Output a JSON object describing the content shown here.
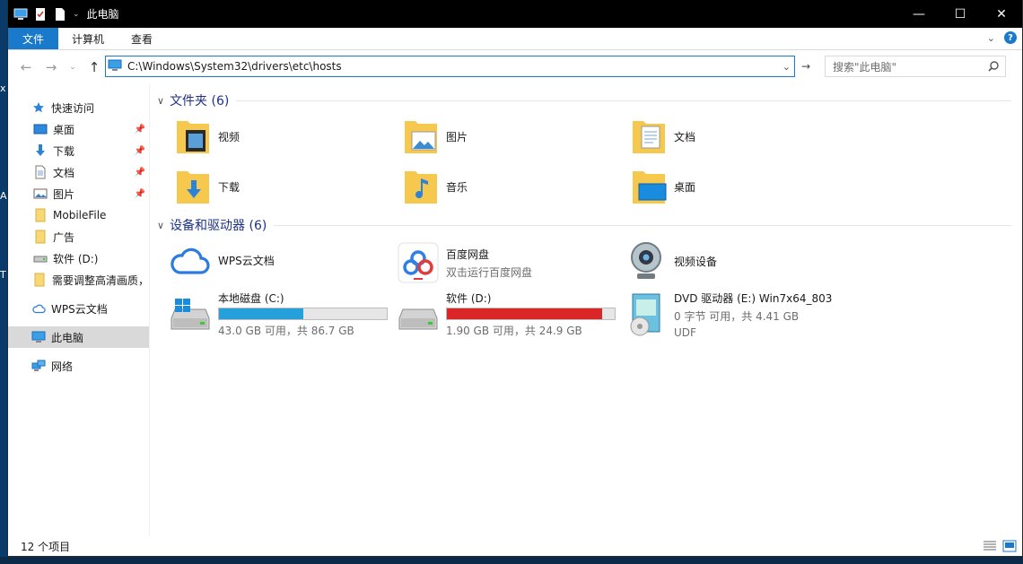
{
  "window": {
    "title": "此电脑"
  },
  "ribbon": {
    "tabs": [
      "文件",
      "计算机",
      "查看"
    ]
  },
  "navbar": {
    "address": "C:\\Windows\\System32\\drivers\\etc\\hosts",
    "search_placeholder": "搜索\"此电脑\""
  },
  "sidebar": {
    "quick_access": "快速访问",
    "pinned": [
      "桌面",
      "下载",
      "文档",
      "图片"
    ],
    "folders": [
      "MobileFile",
      "广告",
      "软件 (D:)",
      "需要调整高清画质，"
    ],
    "wps": "WPS云文档",
    "this_pc": "此电脑",
    "network": "网络"
  },
  "folders": {
    "header": "文件夹 (6)",
    "items": [
      "视频",
      "图片",
      "文档",
      "下载",
      "音乐",
      "桌面"
    ]
  },
  "devices": {
    "header": "设备和驱动器 (6)",
    "wps": "WPS云文档",
    "baidu_name": "百度网盘",
    "baidu_sub": "双击运行百度网盘",
    "video": "视频设备",
    "c_name": "本地磁盘 (C:)",
    "c_sub": "43.0 GB 可用，共 86.7 GB",
    "c_used_fraction": 0.504,
    "d_name": "软件 (D:)",
    "d_sub": "1.90 GB 可用，共 24.9 GB",
    "d_used_fraction": 0.924,
    "dvd_name": "DVD 驱动器 (E:) Win7x64_803",
    "dvd_sub": "0 字节 可用，共 4.41 GB",
    "dvd_fs": "UDF"
  },
  "status": {
    "count": "12 个项目"
  },
  "colors": {
    "accent": "#1979ca",
    "bar_normal": "#26a0da",
    "bar_full": "#da2626",
    "header_text": "#1e3287"
  }
}
